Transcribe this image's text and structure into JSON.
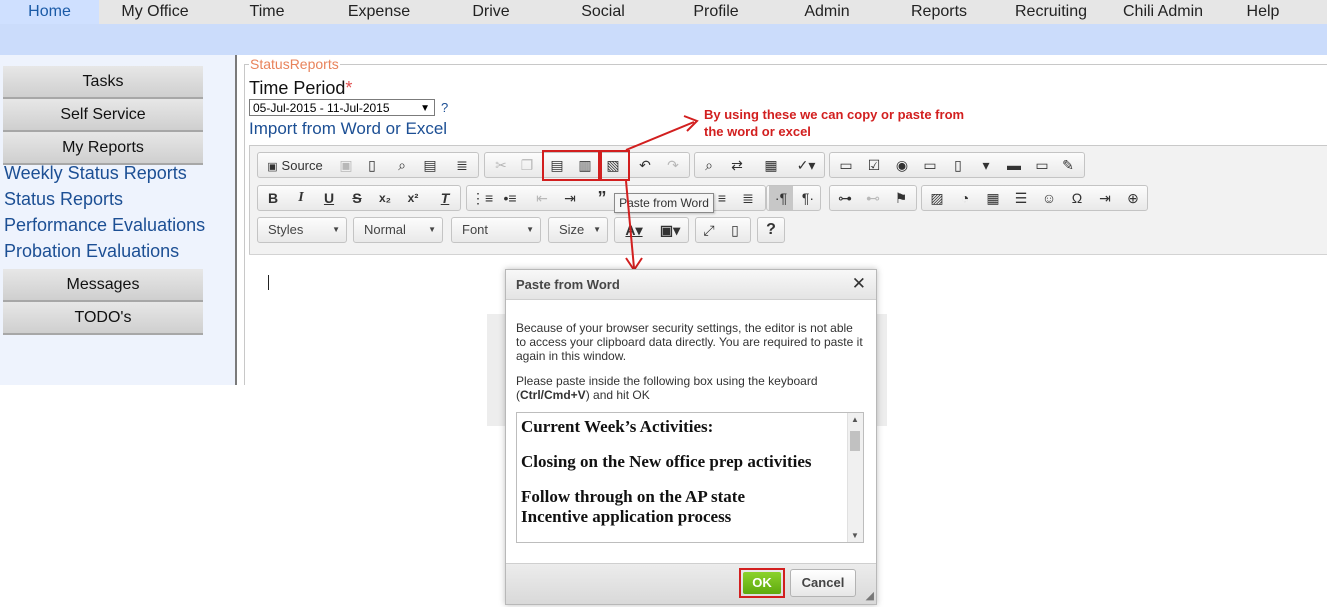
{
  "nav": {
    "items": [
      "Home",
      "My Office",
      "Time",
      "Expense",
      "Drive",
      "Social",
      "Profile",
      "Admin",
      "Reports",
      "Recruiting",
      "Chili Admin",
      "Help"
    ],
    "active": "Home"
  },
  "sidebar": {
    "tasks": "Tasks",
    "self_service": "Self Service",
    "my_reports": "My Reports",
    "links": [
      "Weekly Status Reports",
      "Status Reports",
      "Performance Evaluations",
      "Probation Evaluations"
    ],
    "messages": "Messages",
    "todos": "TODO's"
  },
  "form": {
    "legend": "StatusReports",
    "time_period_label": "Time Period",
    "required_mark": "*",
    "time_period_value": "05-Jul-2015 - 11-Jul-2015",
    "help": "?",
    "import_link": "Import from Word or Excel"
  },
  "toolbar": {
    "source_label": "Source",
    "styles": "Styles",
    "format": "Normal",
    "font": "Font",
    "size": "Size",
    "tooltip": "Paste from Word"
  },
  "annotation": {
    "text": "By using these we can copy or paste from the word or excel",
    "color": "#d21f1f"
  },
  "dialog": {
    "title": "Paste from Word",
    "message1": "Because of your browser security settings, the editor is not able to access your clipboard data directly. You are required to paste it again in this window.",
    "message2_prefix": "Please paste inside the following box using the keyboard (",
    "message2_keys": "Ctrl/Cmd+V",
    "message2_suffix": ") and hit OK",
    "pasted_lines": [
      "Current Week’s Activities:",
      "",
      "Closing on the New office prep activities",
      "",
      "Follow through on the AP state",
      "Incentive application process"
    ],
    "ok_label": "OK",
    "cancel_label": "Cancel"
  },
  "colors": {
    "nav_bar": "#e6e6e6",
    "blue_band": "#cbdcfb",
    "link": "#1c4f94",
    "ok_green": "#6fbb19",
    "highlight_red": "#d21f1f"
  }
}
